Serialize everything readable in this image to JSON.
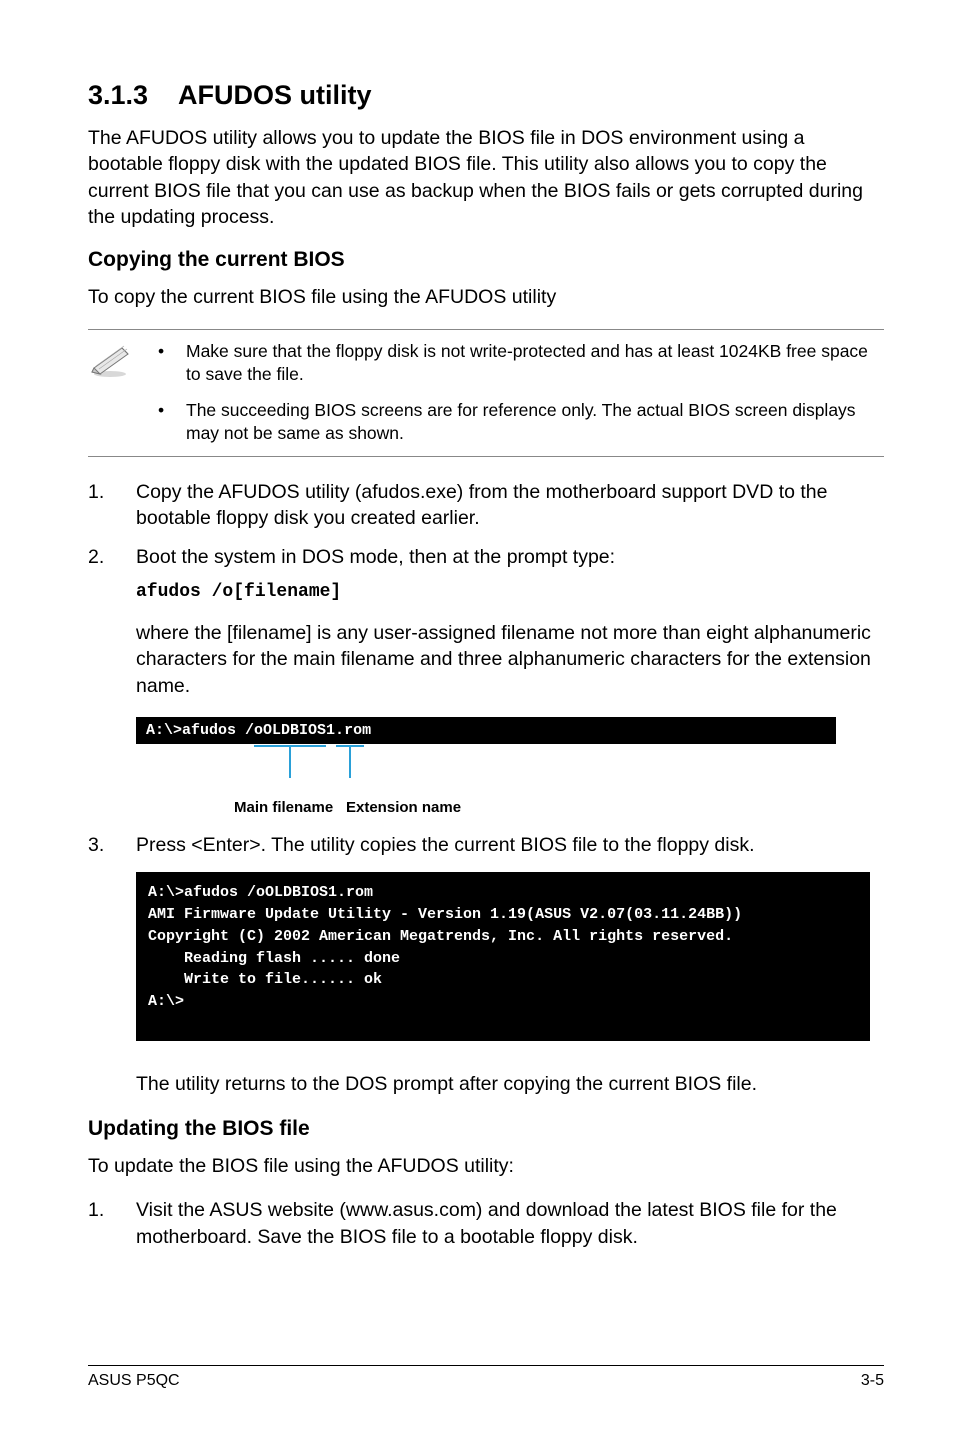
{
  "heading": {
    "num": "3.1.3",
    "title": "AFUDOS utility"
  },
  "intro": "The AFUDOS utility allows you to update the BIOS file in DOS environment using a bootable floppy disk with the updated BIOS file. This utility also allows you to copy the current BIOS file that you can use as backup when the BIOS fails or gets corrupted during the updating process.",
  "copy_section": {
    "heading": "Copying the current BIOS",
    "lead": "To copy the current BIOS file using the AFUDOS utility",
    "notes": [
      "Make sure that the floppy disk is not write-protected and has at least 1024KB free space to save the file.",
      "The succeeding BIOS screens are for reference only. The actual BIOS screen displays may not be same as shown."
    ],
    "step1": "Copy the AFUDOS utility (afudos.exe) from the motherboard support DVD to the bootable floppy disk you created earlier.",
    "step2": "Boot the system in DOS mode, then at the prompt type:",
    "step2_cmd": "afudos /o[filename]",
    "step2_desc": "where the [filename] is any user-assigned filename not more than eight alphanumeric characters  for the main filename and three alphanumeric characters for the extension name.",
    "term_small_prefix": "A:\\>afudos /o",
    "term_small_main": "OLDBIOS1",
    "term_small_dot": ".",
    "term_small_ext": "rom",
    "label_main": "Main filename",
    "label_ext": "Extension name",
    "step3": "Press <Enter>. The utility copies the current BIOS file to the floppy disk.",
    "term_large": "A:\\>afudos /oOLDBIOS1.rom\nAMI Firmware Update Utility - Version 1.19(ASUS V2.07(03.11.24BB))\nCopyright (C) 2002 American Megatrends, Inc. All rights reserved.\n    Reading flash ..... done\n    Write to file...... ok\nA:\\>",
    "after": "The utility returns to the DOS prompt after copying the current BIOS file."
  },
  "update_section": {
    "heading": "Updating the BIOS file",
    "lead": "To update the BIOS file using the AFUDOS utility:",
    "step1": "Visit the ASUS website (www.asus.com) and download the latest BIOS file for the motherboard. Save the BIOS file to a bootable floppy disk."
  },
  "footer": {
    "left": "ASUS P5QC",
    "right": "3-5"
  }
}
